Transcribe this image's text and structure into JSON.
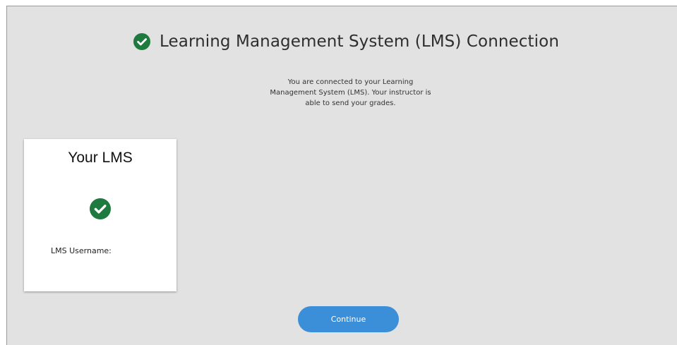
{
  "header": {
    "title": "Learning Management System (LMS) Connection",
    "status_icon": "check-circle-icon"
  },
  "main": {
    "description": "You are connected to your Learning Management System (LMS). Your instructor is able to send your grades."
  },
  "lms_card": {
    "title": "Your LMS",
    "status_icon": "check-circle-icon",
    "username_label": "LMS Username:",
    "username_value": ""
  },
  "actions": {
    "continue_label": "Continue"
  },
  "colors": {
    "success_green": "#1e7a3e",
    "primary_blue": "#3b8fd9",
    "background": "#e2e2e2"
  }
}
